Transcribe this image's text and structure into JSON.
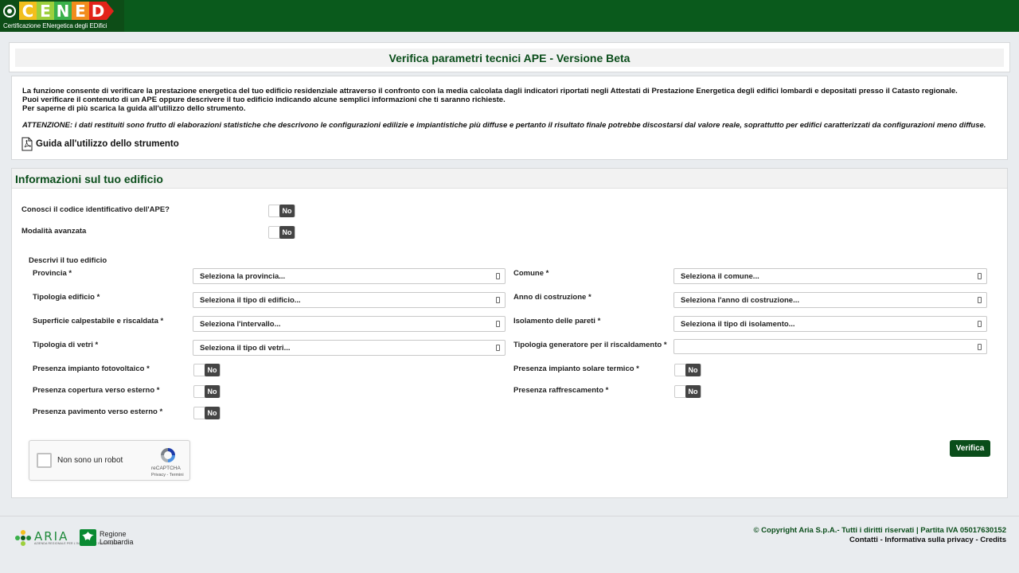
{
  "brand": {
    "letters": [
      "C",
      "E",
      "N",
      "E",
      "D"
    ],
    "letter_colors": [
      "#f2bf1d",
      "#9ccf3c",
      "#3ab04a",
      "#f28c1c",
      "#e2231a"
    ],
    "subtitle": "Certificazione ENergetica degli EDifici"
  },
  "page_title": "Verifica parametri tecnici APE - Versione Beta",
  "intro": {
    "lines": [
      "La funzione consente di verificare la prestazione energetica del tuo edificio residenziale attraverso il confronto con la media calcolata dagli indicatori riportati negli Attestati di Prestazione Energetica degli edifici lombardi e depositati presso il Catasto regionale.",
      "Puoi verificare il contenuto di un APE oppure descrivere il tuo edificio indicando alcune semplici informazioni che ti saranno richieste.",
      "Per saperne di più scarica la guida all'utilizzo dello strumento."
    ],
    "warning": "ATTENZIONE: i dati restituiti sono frutto di elaborazioni statistiche che descrivono le configurazioni edilizie e impiantistiche più diffuse e pertanto il risultato finale potrebbe discostarsi dal valore reale, soprattutto per edifici caratterizzati da configurazioni meno diffuse.",
    "guide_link": "Guida all'utilizzo dello strumento"
  },
  "form": {
    "section_title": "Informazioni sul tuo edificio",
    "toggle_value": "No",
    "know_ape_code": "Conosci il codice identificativo dell'APE?",
    "advanced_mode": "Modalità avanzata",
    "describe_heading": "Descrivi il tuo edificio",
    "provincia": {
      "label": "Provincia",
      "placeholder": "Seleziona la provincia..."
    },
    "comune": {
      "label": "Comune",
      "placeholder": "Seleziona il comune..."
    },
    "tipologia_edificio": {
      "label": "Tipologia edificio",
      "placeholder": "Seleziona il tipo di edificio..."
    },
    "anno_costruzione": {
      "label": "Anno di costruzione",
      "placeholder": "Seleziona l'anno di costruzione..."
    },
    "superficie": {
      "label": "Superficie calpestabile e riscaldata",
      "placeholder": "Seleziona l'intervallo..."
    },
    "isolamento": {
      "label": "Isolamento delle pareti",
      "placeholder": "Seleziona il tipo di isolamento..."
    },
    "tipologia_vetri": {
      "label": "Tipologia di vetri",
      "placeholder": "Seleziona il tipo di vetri..."
    },
    "generatore": {
      "label": "Tipologia generatore per il riscaldamento",
      "placeholder": ""
    },
    "fotovoltaico": "Presenza impianto fotovoltaico",
    "solare_termico": "Presenza impianto solare termico",
    "copertura": "Presenza copertura verso esterno",
    "raffrescamento": "Presenza raffrescamento",
    "pavimento": "Presenza pavimento verso esterno",
    "required_mark": "*",
    "verify_button": "Verifica"
  },
  "captcha": {
    "label": "Non sono un robot",
    "brand": "reCAPTCHA",
    "links": "Privacy - Termini"
  },
  "footer": {
    "aria_name": "ARIA",
    "aria_tagline": "AZIENDA REGIONALE PER L'INNOVAZIONE E GLI ACQUISTI",
    "region_line1": "Regione",
    "region_line2": "Lombardia",
    "copyright": "© Copyright Aria S.p.A.- Tutti i diritti riservati | Partita IVA 05017630152",
    "link_contatti": "Contatti",
    "link_privacy": "Informativa sulla privacy",
    "link_credits": "Credits",
    "separator": " - "
  },
  "colors": {
    "header_green": "#0a5a1c",
    "title_green": "#0a4d1a",
    "toggle_dark": "#444444"
  }
}
